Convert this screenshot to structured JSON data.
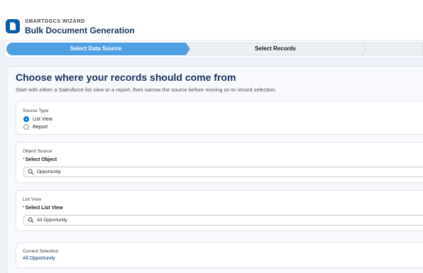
{
  "app": {
    "eyebrow": "SMARTDOCS WIZARD",
    "title": "Bulk Document Generation",
    "icon": "document-icon",
    "brand_color": "#0b5cab"
  },
  "path": {
    "steps": [
      {
        "label": "Select Data Source",
        "state": "active"
      },
      {
        "label": "Select Records",
        "state": "inactive"
      }
    ],
    "active_color": "#4f9fe3"
  },
  "main": {
    "title": "Choose where your records should come from",
    "subtitle": "Start with either a Salesforce list view or a report, then narrow the source before moving on to record selection."
  },
  "source_type": {
    "label": "Source Type",
    "options": [
      {
        "label": "List View",
        "checked": true
      },
      {
        "label": "Report",
        "checked": false
      }
    ]
  },
  "object_source": {
    "label": "Object Source",
    "field_label": "Select Object",
    "required_mark": "*",
    "value": "Opportunity",
    "icon": "search-icon"
  },
  "list_view": {
    "label": "List View",
    "field_label": "Select List View",
    "required_mark": "*",
    "value": "All Opportunity",
    "icon": "search-icon"
  },
  "current_selection": {
    "label": "Current Selection",
    "value": "All Opportunity"
  }
}
